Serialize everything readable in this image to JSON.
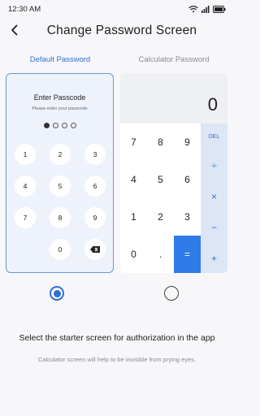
{
  "status": {
    "time": "12:30 AM",
    "battery_label": "100"
  },
  "header": {
    "title": "Change Password Screen"
  },
  "tabs": [
    {
      "label": "Default Password",
      "active": true
    },
    {
      "label": "Calculator Password",
      "active": false
    }
  ],
  "passcode": {
    "title": "Enter Passcode",
    "subtitle": "Please enter your passcode",
    "filled_dots": 1,
    "total_dots": 4,
    "keys": [
      "1",
      "2",
      "3",
      "4",
      "5",
      "6",
      "7",
      "8",
      "9",
      "0"
    ]
  },
  "calculator": {
    "display": "0",
    "keys": {
      "del": "DEL",
      "divide": "÷",
      "multiply": "×",
      "minus": "−",
      "plus": "+",
      "equals": "=",
      "dot": ".",
      "zero": "0",
      "seven": "7",
      "eight": "8",
      "nine": "9",
      "four": "4",
      "five": "5",
      "six": "6",
      "one": "1",
      "two": "2",
      "three": "3"
    }
  },
  "selection": {
    "default_selected": true,
    "calculator_selected": false
  },
  "texts": {
    "instruction": "Select the starter screen for authorization in the app",
    "hint": "Calculator screen will help to be invisible from prying eyes."
  },
  "colors": {
    "accent": "#2f6fd3",
    "equals_button": "#2f7be8",
    "operator_bg": "#dde6f5"
  },
  "icons": [
    "wifi-icon",
    "signal-icon",
    "battery-icon",
    "back-arrow-icon",
    "backspace-icon"
  ]
}
